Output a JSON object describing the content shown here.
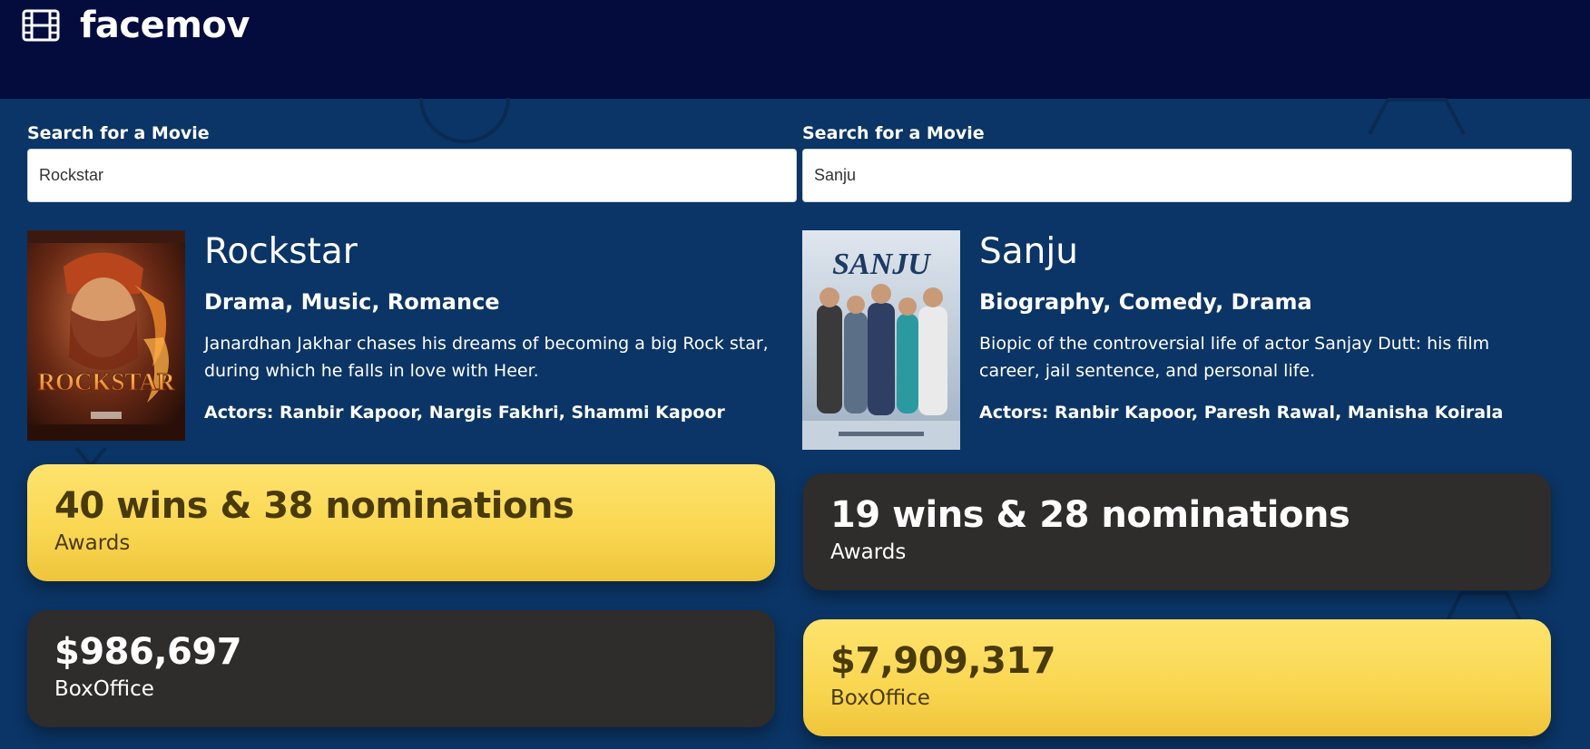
{
  "app": {
    "name": "facemov",
    "logo_icon": "film-icon"
  },
  "colors": {
    "header_bg": "#030c3d",
    "page_bg": "#0b3566",
    "winner_card": "#fbd858",
    "loser_card": "#2f2c2c"
  },
  "left": {
    "search": {
      "label": "Search for a Movie",
      "value": "Rockstar"
    },
    "movie": {
      "title": "Rockstar",
      "genre": "Drama, Music, Romance",
      "plot": "Janardhan Jakhar chases his dreams of becoming a big Rock star, during which he falls in love with Heer.",
      "actors": "Actors: Ranbir Kapoor, Nargis Fakhri, Shammi Kapoor",
      "poster_text": "ROCKSTAR"
    },
    "stats": [
      {
        "value": "40 wins & 38 nominations",
        "label": "Awards",
        "winner": true
      },
      {
        "value": "$986,697",
        "label": "BoxOffice",
        "winner": false
      }
    ]
  },
  "right": {
    "search": {
      "label": "Search for a Movie",
      "value": "Sanju"
    },
    "movie": {
      "title": "Sanju",
      "genre": "Biography, Comedy, Drama",
      "plot": "Biopic of the controversial life of actor Sanjay Dutt: his film career, jail sentence, and personal life.",
      "actors": "Actors: Ranbir Kapoor, Paresh Rawal, Manisha Koirala",
      "poster_text": "SANJU"
    },
    "stats": [
      {
        "value": "19 wins & 28 nominations",
        "label": "Awards",
        "winner": false
      },
      {
        "value": "$7,909,317",
        "label": "BoxOffice",
        "winner": true
      }
    ]
  }
}
